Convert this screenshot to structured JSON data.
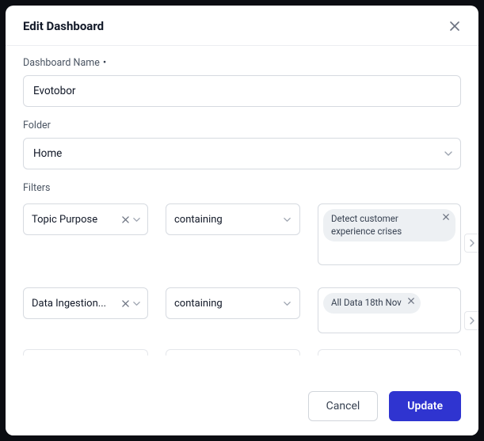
{
  "modal": {
    "title": "Edit Dashboard"
  },
  "fields": {
    "dashboard_name": {
      "label": "Dashboard Name",
      "required_marker": "•",
      "value": "Evotobor"
    },
    "folder": {
      "label": "Folder",
      "value": "Home"
    }
  },
  "filters": {
    "label": "Filters",
    "rows": [
      {
        "field": "Topic Purpose",
        "operator": "containing",
        "tags": [
          {
            "text": "Detect customer experience crises"
          }
        ]
      },
      {
        "field": "Data Ingestion...",
        "operator": "containing",
        "tags": [
          {
            "text": "All Data 18th Nov"
          }
        ]
      }
    ]
  },
  "footer": {
    "cancel": "Cancel",
    "update": "Update"
  }
}
